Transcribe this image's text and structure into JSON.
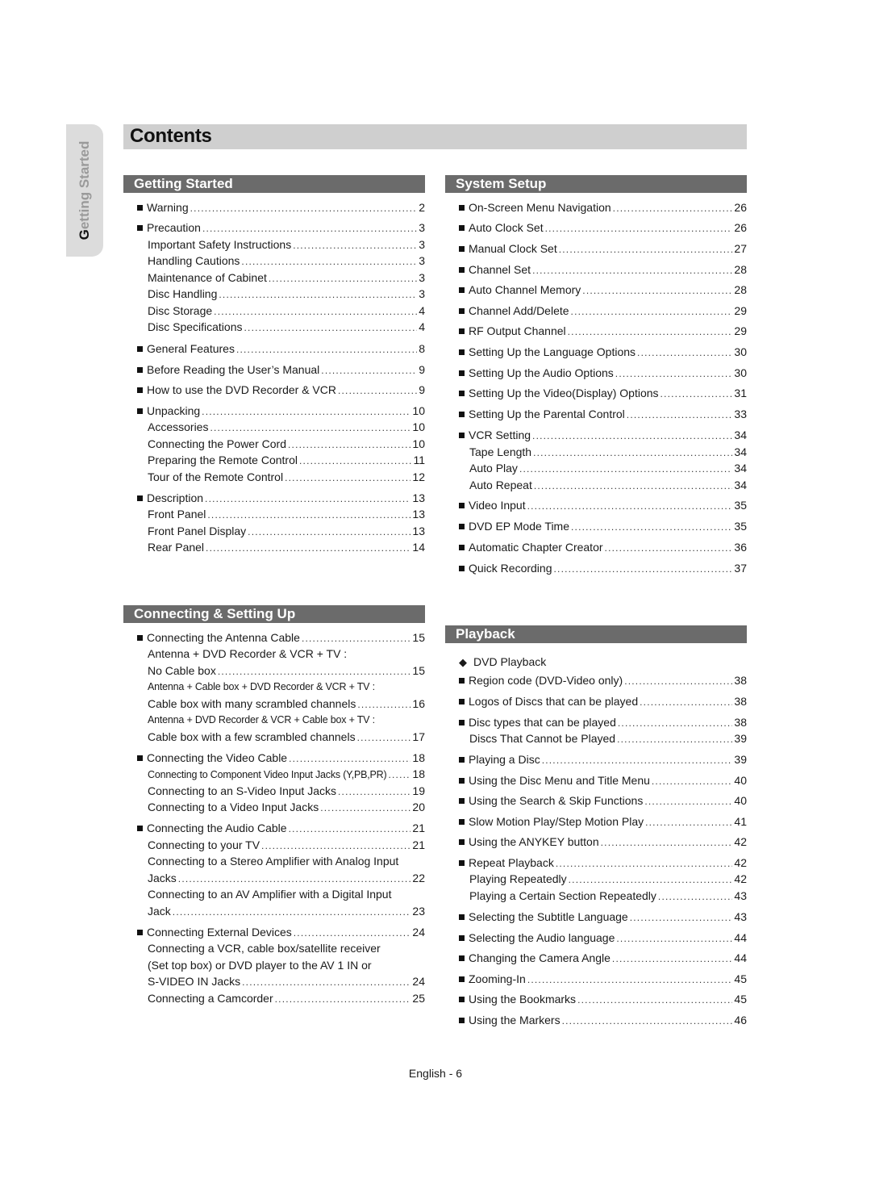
{
  "side_tab": {
    "first_letter": "G",
    "rest": "etting Started"
  },
  "title": "Contents",
  "sections": {
    "getting_started": {
      "heading": "Getting Started",
      "entries": [
        {
          "label": "Warning",
          "page": "2",
          "level": 1
        },
        {
          "label": "Precaution",
          "page": "3",
          "level": 1
        },
        {
          "label": "Important Safety Instructions",
          "page": "3",
          "level": 2
        },
        {
          "label": "Handling Cautions",
          "page": "3",
          "level": 2
        },
        {
          "label": "Maintenance of Cabinet",
          "page": "3",
          "level": 2
        },
        {
          "label": "Disc Handling",
          "page": "3",
          "level": 2
        },
        {
          "label": "Disc Storage",
          "page": "4",
          "level": 2
        },
        {
          "label": "Disc Specifications",
          "page": "4",
          "level": 2
        },
        {
          "label": "General Features",
          "page": "8",
          "level": 1
        },
        {
          "label": "Before Reading the User’s Manual",
          "page": "9",
          "level": 1
        },
        {
          "label": "How to use the DVD Recorder & VCR",
          "page": "9",
          "level": 1
        },
        {
          "label": "Unpacking",
          "page": "10",
          "level": 1
        },
        {
          "label": "Accessories",
          "page": "10",
          "level": 2
        },
        {
          "label": "Connecting the Power Cord",
          "page": "10",
          "level": 2
        },
        {
          "label": "Preparing the Remote Control",
          "page": "11",
          "level": 2
        },
        {
          "label": "Tour of the Remote Control",
          "page": "12",
          "level": 2
        },
        {
          "label": "Description",
          "page": "13",
          "level": 1
        },
        {
          "label": "Front Panel",
          "page": "13",
          "level": 2
        },
        {
          "label": "Front Panel Display",
          "page": "13",
          "level": 2
        },
        {
          "label": "Rear Panel",
          "page": "14",
          "level": 2
        }
      ]
    },
    "connecting": {
      "heading": "Connecting & Setting Up",
      "entries": [
        {
          "label": "Connecting the Antenna Cable",
          "page": "15",
          "level": 1
        },
        {
          "label": "Antenna + DVD Recorder & VCR + TV :",
          "page": "",
          "level": 2
        },
        {
          "label": "No Cable box",
          "page": "15",
          "level": 2
        },
        {
          "label": "Antenna + Cable box + DVD Recorder & VCR + TV :",
          "page": "",
          "level": 2,
          "small": true
        },
        {
          "label": "Cable box with many scrambled channels",
          "page": "16",
          "level": 2
        },
        {
          "label": "Antenna + DVD Recorder & VCR + Cable box + TV :",
          "page": "",
          "level": 2,
          "small": true
        },
        {
          "label": "Cable box with a few scrambled channels",
          "page": "17",
          "level": 2
        },
        {
          "label": "Connecting the Video Cable",
          "page": "18",
          "level": 1
        },
        {
          "label": "Connecting to Component Video Input Jacks (Y,PB,PR)",
          "page": "18",
          "level": 2,
          "small": true
        },
        {
          "label": "Connecting to an S-Video Input Jacks",
          "page": "19",
          "level": 2
        },
        {
          "label": "Connecting to a Video Input Jacks",
          "page": "20",
          "level": 2
        },
        {
          "label": "Connecting the Audio Cable",
          "page": "21",
          "level": 1
        },
        {
          "label": "Connecting to your TV",
          "page": "21",
          "level": 2
        },
        {
          "label": "Connecting to a Stereo Amplifier with Analog Input",
          "page": "",
          "level": 2
        },
        {
          "label": "Jacks",
          "page": "22",
          "level": 2
        },
        {
          "label": "Connecting to an AV Amplifier with a Digital Input",
          "page": "",
          "level": 2
        },
        {
          "label": "Jack",
          "page": "23",
          "level": 2
        },
        {
          "label": "Connecting External Devices",
          "page": "24",
          "level": 1
        },
        {
          "label": "Connecting a VCR, cable box/satellite receiver",
          "page": "",
          "level": 2
        },
        {
          "label": "(Set top box) or DVD player to the AV 1 IN or",
          "page": "",
          "level": 2
        },
        {
          "label": "S-VIDEO IN Jacks",
          "page": "24",
          "level": 2
        },
        {
          "label": "Connecting a Camcorder",
          "page": "25",
          "level": 2
        }
      ]
    },
    "system_setup": {
      "heading": "System Setup",
      "entries": [
        {
          "label": "On-Screen Menu Navigation",
          "page": "26",
          "level": 1
        },
        {
          "label": "Auto Clock Set",
          "page": "26",
          "level": 1
        },
        {
          "label": "Manual Clock Set",
          "page": "27",
          "level": 1
        },
        {
          "label": "Channel Set",
          "page": "28",
          "level": 1
        },
        {
          "label": "Auto Channel Memory",
          "page": "28",
          "level": 1
        },
        {
          "label": "Channel Add/Delete",
          "page": "29",
          "level": 1
        },
        {
          "label": "RF Output Channel",
          "page": "29",
          "level": 1
        },
        {
          "label": "Setting Up the Language Options",
          "page": "30",
          "level": 1
        },
        {
          "label": "Setting Up the Audio Options",
          "page": "30",
          "level": 1
        },
        {
          "label": "Setting Up the Video(Display) Options",
          "page": "31",
          "level": 1
        },
        {
          "label": "Setting Up the Parental Control",
          "page": "33",
          "level": 1
        },
        {
          "label": "VCR Setting",
          "page": "34",
          "level": 1
        },
        {
          "label": "Tape Length",
          "page": "34",
          "level": 2
        },
        {
          "label": "Auto Play",
          "page": "34",
          "level": 2
        },
        {
          "label": "Auto Repeat",
          "page": "34",
          "level": 2
        },
        {
          "label": "Video Input",
          "page": "35",
          "level": 1
        },
        {
          "label": "DVD EP Mode Time",
          "page": "35",
          "level": 1
        },
        {
          "label": "Automatic Chapter Creator",
          "page": "36",
          "level": 1
        },
        {
          "label": "Quick Recording",
          "page": "37",
          "level": 1
        }
      ]
    },
    "playback": {
      "heading": "Playback",
      "entries": [
        {
          "label": "DVD Playback",
          "page": "",
          "level": 0
        },
        {
          "label": "Region code (DVD-Video only)",
          "page": "38",
          "level": 1
        },
        {
          "label": "Logos of Discs that can be played",
          "page": "38",
          "level": 1
        },
        {
          "label": "Disc types that can be played",
          "page": "38",
          "level": 1
        },
        {
          "label": "Discs That Cannot be Played",
          "page": "39",
          "level": 2
        },
        {
          "label": "Playing a Disc",
          "page": "39",
          "level": 1
        },
        {
          "label": "Using the Disc Menu and Title Menu",
          "page": "40",
          "level": 1
        },
        {
          "label": "Using the Search & Skip Functions",
          "page": "40",
          "level": 1
        },
        {
          "label": "Slow Motion Play/Step Motion Play",
          "page": "41",
          "level": 1
        },
        {
          "label": "Using the ANYKEY button",
          "page": "42",
          "level": 1
        },
        {
          "label": "Repeat Playback",
          "page": "42",
          "level": 1
        },
        {
          "label": "Playing Repeatedly",
          "page": "42",
          "level": 2
        },
        {
          "label": "Playing a Certain Section Repeatedly",
          "page": "43",
          "level": 2
        },
        {
          "label": "Selecting the Subtitle Language",
          "page": "43",
          "level": 1
        },
        {
          "label": "Selecting the Audio language",
          "page": "44",
          "level": 1
        },
        {
          "label": "Changing the Camera Angle",
          "page": "44",
          "level": 1
        },
        {
          "label": "Zooming-In",
          "page": "45",
          "level": 1
        },
        {
          "label": "Using the Bookmarks",
          "page": "45",
          "level": 1
        },
        {
          "label": "Using the Markers",
          "page": "46",
          "level": 1
        }
      ]
    }
  },
  "footer": "English - 6"
}
